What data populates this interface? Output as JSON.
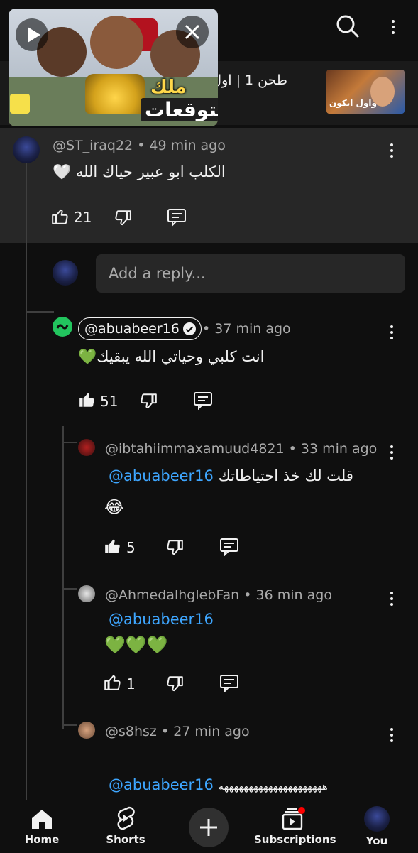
{
  "miniplayer": {
    "thumb_title_line1": "ملك",
    "thumb_title_line2": "التوقعات"
  },
  "video_row": {
    "title": "طحن 1 | اول",
    "thumb_caption": "واول ابكون"
  },
  "comment": {
    "handle": "@ST_iraq22",
    "time": "49 min ago",
    "text": "الكلب ابو عبير حياك الله 🤍",
    "likes": "21"
  },
  "reply_box": {
    "placeholder": "Add a reply..."
  },
  "replies": [
    {
      "handle": "@abuabeer16",
      "time": "37 min ago",
      "text": "انت كلبي وحياتي الله يبقيك💚",
      "likes": "51",
      "verified": true
    },
    {
      "handle": "@ibtahiimmaxamuud4821",
      "time": "33 min ago",
      "mention": "@abuabeer16",
      "text": "قلت لك خذ احتياطاتك",
      "emoji": "😂",
      "likes": "5"
    },
    {
      "handle": "@AhmedalhglebFan",
      "time": "36 min ago",
      "mention": "@abuabeer16",
      "emoji": "💚💚💚",
      "likes": "1"
    },
    {
      "handle": "@s8hsz",
      "time": "27 min ago",
      "mention": "@abuabeer16",
      "text": "هههههههههههههههههههههه"
    }
  ],
  "bottom_nav": {
    "home": "Home",
    "shorts": "Shorts",
    "subscriptions": "Subscriptions",
    "you": "You"
  },
  "colors": {
    "background": "#0f0f0f",
    "highlight": "#272727",
    "mention": "#3ea6ff",
    "badge_red": "#ff0000",
    "heart_green": "#2ecc71"
  },
  "icons": [
    "play-icon",
    "close-icon",
    "search-icon",
    "more-vert-icon",
    "thumb-up-icon",
    "thumb-down-icon",
    "reply-icon",
    "verified-icon",
    "home-icon",
    "shorts-icon",
    "create-icon",
    "subscriptions-icon"
  ]
}
